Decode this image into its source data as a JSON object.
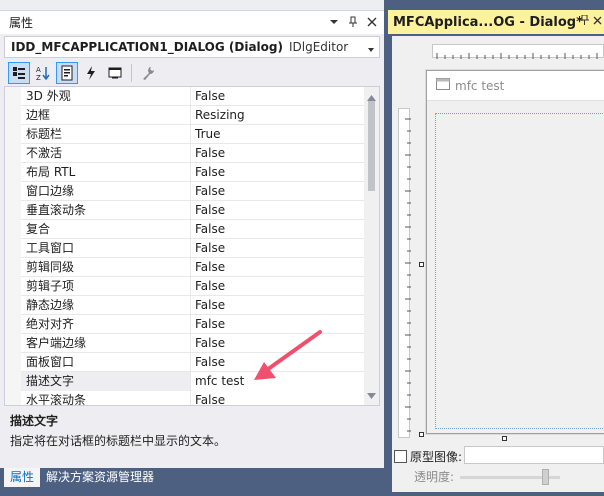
{
  "properties_panel": {
    "title": "属性",
    "object_name": "IDD_MFCAPPLICATION1_DIALOG (Dialog)",
    "object_type": "IDlgEditor",
    "rows": [
      {
        "name": "3D 外观",
        "value": "False"
      },
      {
        "name": "边框",
        "value": "Resizing"
      },
      {
        "name": "标题栏",
        "value": "True"
      },
      {
        "name": "不激活",
        "value": "False"
      },
      {
        "name": "布局 RTL",
        "value": "False"
      },
      {
        "name": "窗口边缘",
        "value": "False"
      },
      {
        "name": "垂直滚动条",
        "value": "False"
      },
      {
        "name": "复合",
        "value": "False"
      },
      {
        "name": "工具窗口",
        "value": "False"
      },
      {
        "name": "剪辑同级",
        "value": "False"
      },
      {
        "name": "剪辑子项",
        "value": "False"
      },
      {
        "name": "静态边缘",
        "value": "False"
      },
      {
        "name": "绝对对齐",
        "value": "False"
      },
      {
        "name": "客户端边缘",
        "value": "False"
      },
      {
        "name": "面板窗口",
        "value": "False"
      },
      {
        "name": "描述文字",
        "value": "mfc test"
      },
      {
        "name": "水平滚动条",
        "value": "False"
      }
    ],
    "selected_row": 15,
    "description_title": "描述文字",
    "description_text": "指定将在对话框的标题栏中显示的文本。",
    "bottom_tabs": [
      "属性",
      "解决方案资源管理器"
    ]
  },
  "designer": {
    "tab_title": "MFCApplica...OG - Dialog*",
    "dialog_title": "mfc test",
    "prototype_label": "原型图像:",
    "opacity_label": "透明度:"
  },
  "colors": {
    "accent": "#3399ff",
    "doc_tab": "#fff29d",
    "annotation_arrow": "#f0506e",
    "frame": "#4d6082"
  }
}
